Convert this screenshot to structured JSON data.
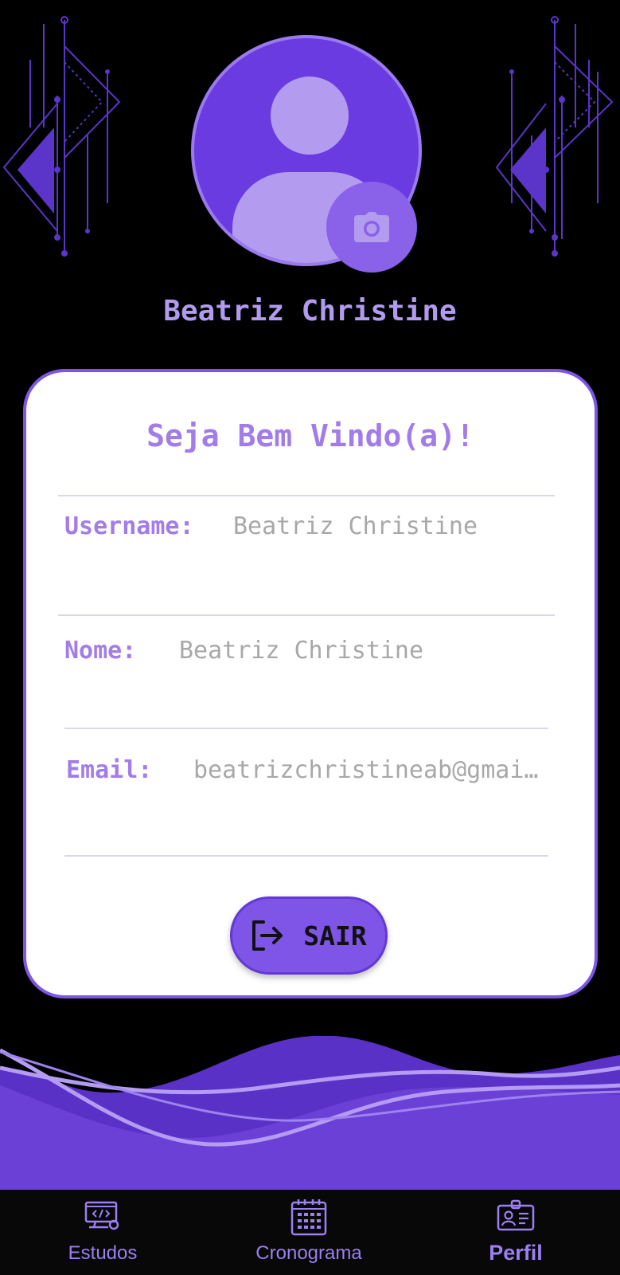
{
  "profile": {
    "name": "Beatriz Christine"
  },
  "card": {
    "welcome": "Seja Bem Vindo(a)!",
    "fields": [
      {
        "label": "Username:",
        "value": "Beatriz Christine"
      },
      {
        "label": "Nome:",
        "value": "Beatriz Christine"
      },
      {
        "label": "Email:",
        "value": "beatrizchristineab@gmail.com"
      }
    ],
    "logout_label": "SAIR"
  },
  "nav": {
    "items": [
      {
        "label": "Estudos",
        "icon": "computer-code-icon",
        "active": false
      },
      {
        "label": "Cronograma",
        "icon": "calendar-icon",
        "active": false
      },
      {
        "label": "Perfil",
        "icon": "id-badge-icon",
        "active": true
      }
    ]
  },
  "colors": {
    "background": "#000000",
    "accent": "#7e55e6",
    "accent_light": "#b29af0",
    "card": "#ffffff",
    "value_text": "#a8a8a8"
  }
}
